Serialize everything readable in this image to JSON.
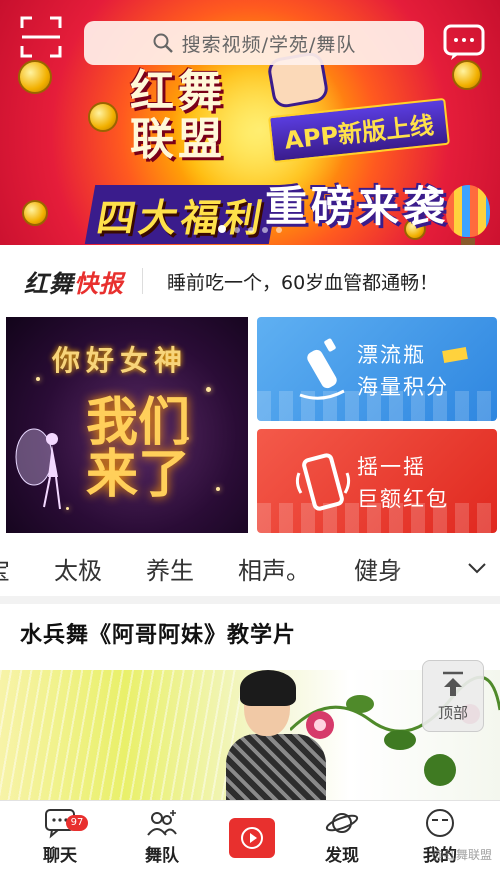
{
  "header": {
    "search_placeholder": "搜索视频/学苑/舞队",
    "scan_icon": "scan-icon",
    "message_icon": "chat-message-icon"
  },
  "banner": {
    "line1": "红舞",
    "line2": "联盟",
    "ribbon": "APP新版上线",
    "line3": "四大福利",
    "line4": "重磅来袭",
    "slide_count": 5,
    "active_slide": 0
  },
  "news": {
    "logo_main": "红舞",
    "logo_accent": "快报",
    "headline": "睡前吃一个，60岁血管都通畅！"
  },
  "promos": {
    "feature": {
      "title": "你好女神",
      "subtitle": "我们来了"
    },
    "drift_bottle": {
      "title": "漂流瓶",
      "subtitle": "海量积分"
    },
    "shake": {
      "title": "摇一摇",
      "subtitle": "巨额红包"
    }
  },
  "categories": [
    "宝",
    "太极",
    "养生",
    "相声。",
    "健身"
  ],
  "video": {
    "title": "水兵舞《阿哥阿妹》教学片"
  },
  "back_to_top": {
    "label": "顶部"
  },
  "nav": {
    "items": [
      {
        "label": "聊天",
        "icon": "chat-bubble-icon",
        "badge": "97"
      },
      {
        "label": "舞队",
        "icon": "team-icon"
      },
      {
        "label": "",
        "icon": "play-icon"
      },
      {
        "label": "发现",
        "icon": "planet-icon"
      },
      {
        "label": "我的",
        "icon": "profile-face-icon"
      }
    ]
  },
  "watermark": "@红舞联盟",
  "colors": {
    "brand_red": "#e8302e",
    "drift_blue": "#3b8fe6",
    "shake_red": "#ea3a2f"
  }
}
